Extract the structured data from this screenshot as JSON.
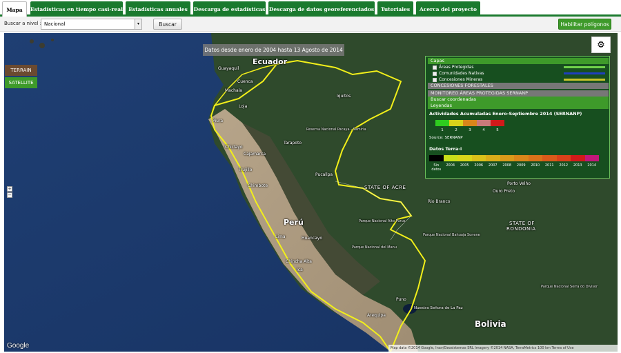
{
  "tabs": [
    {
      "label": "Mapa",
      "active": true
    },
    {
      "label": "Estadísticas en tiempo casi-real",
      "active": false
    },
    {
      "label": "Estadísticas anuales",
      "active": false
    },
    {
      "label": "Descarga de estadísticas",
      "active": false
    },
    {
      "label": "Descarga de datos georeferenciados",
      "active": false
    },
    {
      "label": "Tutoriales",
      "active": false
    },
    {
      "label": "Acerca del proyecto",
      "active": false
    }
  ],
  "search": {
    "label": "Buscar a nivel :",
    "selected": "Nacional",
    "button": "Buscar",
    "polygons_button": "Habilitar polígonos"
  },
  "map": {
    "date_banner": "Datos desde enero de 2004 hasta 13 Agosto de 2014",
    "terrain_button": "TERRAIN",
    "satellite_button": "SATELLITE",
    "zoom_in": "+",
    "zoom_out": "−",
    "gear_icon": "gear-icon",
    "countries": {
      "ecuador": "Ecuador",
      "peru": "Perú",
      "bolivia": "Bolivia"
    },
    "states": {
      "acre": "STATE OF ACRE",
      "rondonia_1": "STATE OF",
      "rondonia_2": "RONDONIA"
    },
    "cities": {
      "guayaquil": "Guayaquil",
      "cuenca": "Cuenca",
      "loja": "Loja",
      "machala": "Machala",
      "piura": "Piura",
      "chiclayo": "Chiclayo",
      "trujillo": "Trujillo",
      "chimbote": "Chimbote",
      "lima": "Lima",
      "huancayo": "Huancayo",
      "ica": "Ica",
      "arequipa": "Arequipa",
      "iquitos": "Iquitos",
      "pucallpa": "Pucallpa",
      "cajamarca": "Cajamarca",
      "tarapoto": "Tarapoto",
      "rio_branco": "Rio Branco",
      "porto_velho": "Porto Velho",
      "ouro_preto": "Ouro Preto",
      "la_paz": "Nuestra Señora de La Paz",
      "chincha": "Chincha Alta",
      "puno": "Puno"
    },
    "parks": {
      "pacaya": "Reserva Nacional Pacaya - Samiria",
      "alto_purus": "Parque Nacional Alto Purus",
      "manu": "Parque Nacional del Manu",
      "bahuaja": "Parque Nacional Bahuaja Sonene",
      "serra_divisor": "Parque Nacional Serra do Divisor"
    },
    "google": "Google",
    "attribution": "Map data ©2014 Google, Inav/Geosistemas SRL Imagery ©2014 NASA, TerraMetrics   100 km   Terms of Use"
  },
  "panel": {
    "capas_header": "Capas",
    "layers": [
      {
        "label": "Áreas Protegidas",
        "color": "#6fd14a"
      },
      {
        "label": "Comunidades Nativas",
        "color": "#1e3fbf"
      },
      {
        "label": "Concesiones Mineras",
        "color": "#c9c32a"
      }
    ],
    "concesiones_header": "CONCESIONES FORESTALES",
    "monitoreo_header": "MONITOREO ÁREAS PROTEGIDAS SERNANP",
    "coords_header": "Buscar coordenadas",
    "leyendas_header": "Leyendas",
    "acumuladas_title": "Actividades Acumuladas Enero-Septiembre 2014 (SERNANP)",
    "acumuladas": [
      {
        "label": "1",
        "color": "#2ecc1f"
      },
      {
        "label": "2",
        "color": "#d9d21a"
      },
      {
        "label": "3",
        "color": "#d9861a"
      },
      {
        "label": "4",
        "color": "#c97a7a"
      },
      {
        "label": "5",
        "color": "#d11a1a"
      }
    ],
    "source": "Source: SERNANP",
    "terra_title": "Datos Terra-i",
    "terra": [
      {
        "label": "Sin datos",
        "color": "#000000"
      },
      {
        "label": "2004",
        "color": "#c8e01a"
      },
      {
        "label": "2005",
        "color": "#d9d71a"
      },
      {
        "label": "2006",
        "color": "#d9c21a"
      },
      {
        "label": "2007",
        "color": "#d9ad1a"
      },
      {
        "label": "2008",
        "color": "#d99a1a"
      },
      {
        "label": "2009",
        "color": "#d9861a"
      },
      {
        "label": "2010",
        "color": "#d9721a"
      },
      {
        "label": "2011",
        "color": "#d95a1a"
      },
      {
        "label": "2012",
        "color": "#d9411a"
      },
      {
        "label": "2013",
        "color": "#d11a1a"
      },
      {
        "label": "2014",
        "color": "#c2187a"
      }
    ]
  }
}
